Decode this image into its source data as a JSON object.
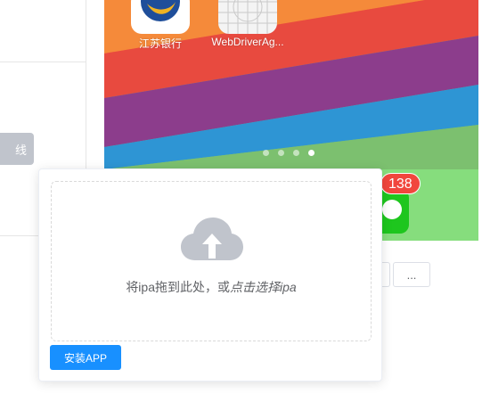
{
  "left_panel": {
    "offline_button_label": "线"
  },
  "phone": {
    "apps": [
      {
        "label": "江苏银行",
        "icon": "bank-icon"
      },
      {
        "label": "WebDriverAg...",
        "icon": "webdriveragent-icon"
      }
    ],
    "page_dots": {
      "count": 4,
      "active_index": 3
    },
    "dock": {
      "messages_badge": "138"
    }
  },
  "controls": {
    "more_label": "..."
  },
  "upload": {
    "icon": "cloud-upload-icon",
    "text_prefix": "将ipa拖到此处，或",
    "text_link": "点击选择ipa",
    "install_button_label": "安装APP"
  },
  "colors": {
    "primary": "#1890ff",
    "disabled": "#c0c4cc",
    "badge": "#f1463d"
  }
}
